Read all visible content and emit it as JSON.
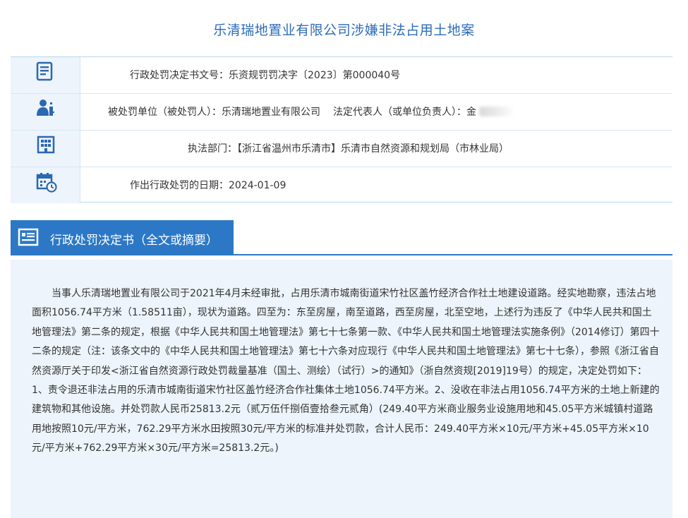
{
  "page": {
    "title": "乐清瑞地置业有限公司涉嫌非法占用土地案"
  },
  "info": {
    "doc_no": {
      "label": "行政处罚决定书文号：",
      "value": "乐资规罚罚决字〔2023〕第000040号"
    },
    "party": {
      "label": "被处罚单位（被处罚人）：",
      "value": "乐清瑞地置业有限公司",
      "rep_label": "法定代表人（或单位负责人）：",
      "rep_value": "金"
    },
    "dept": {
      "label": "执法部门：",
      "value": "【浙江省温州市乐清市】乐清市自然资源和规划局（市林业局）"
    },
    "date": {
      "label": "作出行政处罚的日期：",
      "value": "2024-01-09"
    }
  },
  "icons": {
    "doc": "document-icon",
    "person": "person-icon",
    "building": "building-icon",
    "calendar": "calendar-clock-icon",
    "section": "document-list-icon"
  },
  "section": {
    "title": "行政处罚决定书（全文或摘要）"
  },
  "content": {
    "text": "当事人乐清瑞地置业有限公司于2021年4月未经审批，占用乐清市城南街道宋竹社区盖竹经济合作社土地建设道路。经实地勘察，违法占地面积1056.74平方米（1.58511亩），现状为道路。四至为：东至房屋，南至道路，西至房屋，北至空地，上述行为违反了《中华人民共和国土地管理法》第二条的规定，根据《中华人民共和国土地管理法》第七十七条第一款、《中华人民共和国土地管理法实施条例》（2014修订）第四十二条的规定（注：该条文中的《中华人民共和国土地管理法》第七十六条对应现行《中华人民共和国土地管理法》第七十七条），参照《浙江省自然资源厅关于印发<浙江省自然资源行政处罚裁量基准（国土、测绘）（试行）>的通知》（浙自然资规[2019]19号）的规定，决定处罚如下：1、责令退还非法占用的乐清市城南街道宋竹社区盖竹经济合作社集体土地1056.74平方米。2、没收在非法占用1056.74平方米的土地上新建的建筑物和其他设施。并处罚款人民币25813.2元（贰万伍仟捌佰壹拾叁元贰角）(249.40平方米商业服务业设施用地和45.05平方米城镇村道路用地按照10元/平方米，762.29平方米水田按照30元/平方米的标准并处罚款，合计人民币：249.40平方米×10元/平方米+45.05平方米×10元/平方米+762.29平方米×30元/平方米=25813.2元。)"
  },
  "colors": {
    "accent": "#2c78c6",
    "title": "#2b6cb8",
    "light_bg": "#edf4fb",
    "border": "#b9d5ec"
  }
}
